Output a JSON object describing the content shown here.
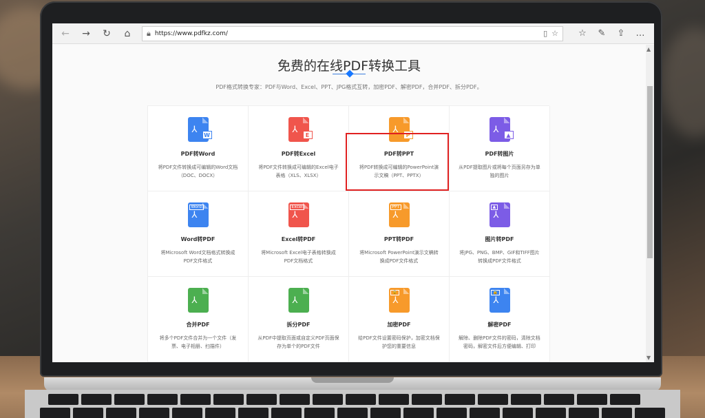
{
  "browser": {
    "url": "https://www.pdfkz.com/",
    "icons": [
      "back-icon",
      "forward-icon",
      "refresh-icon",
      "home-icon",
      "lock-icon",
      "reading-view-icon",
      "favorite-star-icon",
      "favorites-icon",
      "pen-icon",
      "share-icon",
      "more-icon"
    ]
  },
  "hero": {
    "title": "免费的在线PDF转换工具",
    "subtitle": "PDF格式转换专家：PDF与Word、Excel、PPT、JPG格式互转，加密PDF、解密PDF，合并PDF、拆分PDF。"
  },
  "tools": [
    {
      "name": "PDF转Word",
      "desc": "将PDF文件转换成可编辑的Word文档（DOC、DOCX）",
      "color": "#3d84f0",
      "tag": "W"
    },
    {
      "name": "PDF转Excel",
      "desc": "将PDF文件转换成可编辑的Excel电子表格（XLS、XLSX）",
      "color": "#f0554c",
      "tag": "E"
    },
    {
      "name": "PDF转PPT",
      "desc": "将PDF转换成可编辑的PowerPoint演示文稿（PPT、PPTX）",
      "color": "#f79a2b",
      "tag": "P"
    },
    {
      "name": "PDF转图片",
      "desc": "从PDF提取图片或将每个页面另存为单独的图片",
      "color": "#7c5ce6",
      "tag": "▲"
    },
    {
      "name": "Word转PDF",
      "desc": "将Microsoft Word文档格式转换成PDF文件格式",
      "color": "#3d84f0",
      "top": "Word"
    },
    {
      "name": "Excel转PDF",
      "desc": "将Microsoft Excel电子表格转换成PDF文档格式",
      "color": "#f0554c",
      "top": "Excel"
    },
    {
      "name": "PPT转PDF",
      "desc": "将Microsoft PowerPoint演示文稿转换成PDF文件格式",
      "color": "#f79a2b",
      "top": "PPT"
    },
    {
      "name": "图片转PDF",
      "desc": "将JPG、PNG、BMP、GIF和TIFF图片转换成PDF文件格式",
      "color": "#7c5ce6",
      "top": "▲"
    },
    {
      "name": "合并PDF",
      "desc": "将多个PDF文件合并为一个文件（发票、电子相册、扫描件）",
      "color": "#4caf50"
    },
    {
      "name": "拆分PDF",
      "desc": "从PDF中提取页面或自定义PDF页面保存为单个的PDF文件",
      "color": "#4caf50"
    },
    {
      "name": "加密PDF",
      "desc": "给PDF文件设置密码保护，加密文档保护您的重要信息",
      "color": "#f79a2b",
      "top": "🔒"
    },
    {
      "name": "解密PDF",
      "desc": "解除、删除PDF文件的密码，清除文档密码，解密文件后方便编辑、打印",
      "color": "#3d84f0",
      "top": "🔓"
    }
  ],
  "highlighted_tool": "PDF转PPT"
}
